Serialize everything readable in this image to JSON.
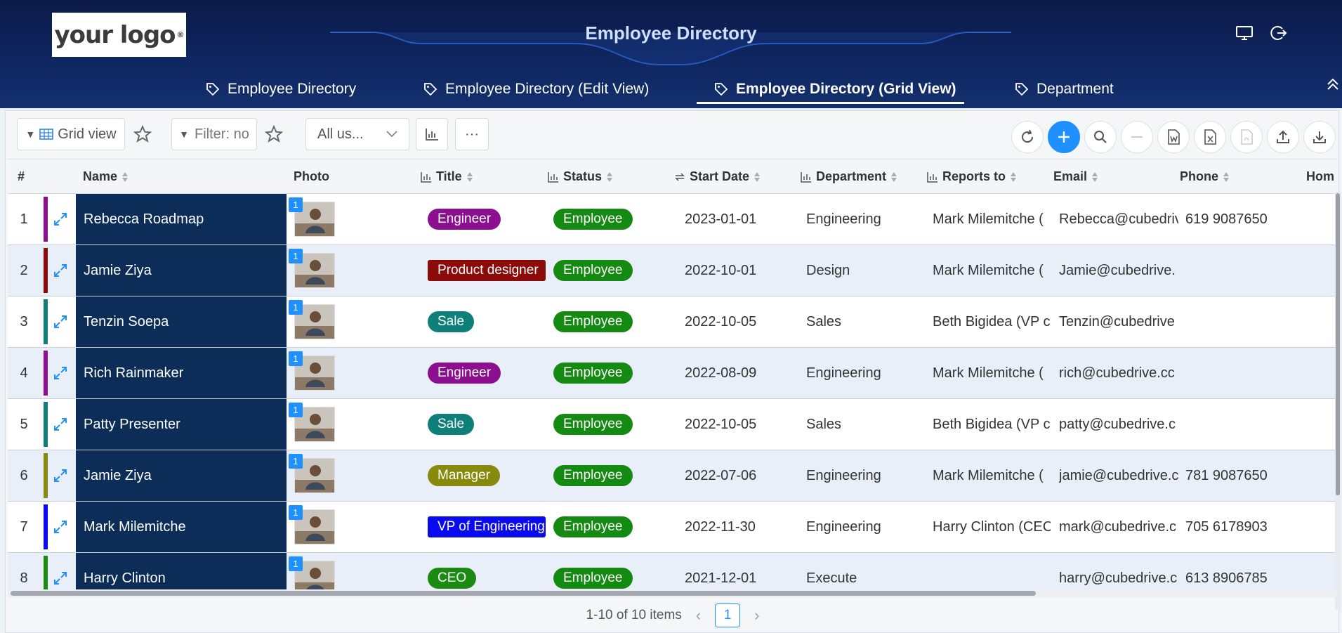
{
  "logo": {
    "text": "your logo",
    "mark": "®"
  },
  "app_title": "Employee Directory",
  "header_icons": [
    "monitor-icon",
    "logout-icon"
  ],
  "tabs": [
    {
      "label": "Employee Directory",
      "icon": "tag-icon",
      "active": false
    },
    {
      "label": "Employee Directory (Edit View)",
      "icon": "tag-icon",
      "active": false
    },
    {
      "label": "Employee Directory (Grid View)",
      "icon": "tag-icon",
      "active": true
    },
    {
      "label": "Department",
      "icon": "tag-icon",
      "active": false
    }
  ],
  "toolbar": {
    "view_label": "Grid view",
    "filter_placeholder": "Filter: no",
    "user_select": "All us...",
    "more_label": "···",
    "actions": [
      "refresh-icon",
      "add-icon",
      "search-icon",
      "remove-icon",
      "word-export-icon",
      "excel-export-icon",
      "pdf-export-icon",
      "upload-icon",
      "download-icon"
    ]
  },
  "columns": {
    "num": "#",
    "name": "Name",
    "photo": "Photo",
    "title": "Title",
    "status": "Status",
    "start_date": "Start Date",
    "department": "Department",
    "reports_to": "Reports to",
    "email": "Email",
    "phone": "Phone",
    "home": "Hom"
  },
  "rows": [
    {
      "num": "1",
      "name": "Rebecca Roadmap",
      "badge": "1",
      "title": "Engineer",
      "title_color": "#8b0f8e",
      "status": "Employee",
      "start_date": "2023-01-01",
      "department": "Engineering",
      "reports_to": "Mark Milemitche (",
      "email": "Rebecca@cubedriv",
      "phone": "619 9087650",
      "bar_color": "#8b0f8e"
    },
    {
      "num": "2",
      "name": "Jamie Ziya",
      "badge": "1",
      "title": "Product designer",
      "title_color": "#8b0a0a",
      "status": "Employee",
      "start_date": "2022-10-01",
      "department": "Design",
      "reports_to": "Mark Milemitche (",
      "email": "Jamie@cubedrive.",
      "phone": "",
      "bar_color": "#8b0a0a"
    },
    {
      "num": "3",
      "name": "Tenzin Soepa",
      "badge": "1",
      "title": "Sale",
      "title_color": "#0f7f7a",
      "status": "Employee",
      "start_date": "2022-10-05",
      "department": "Sales",
      "reports_to": "Beth Bigidea (VP c",
      "email": "Tenzin@cubedrive",
      "phone": "",
      "bar_color": "#0f7f7a"
    },
    {
      "num": "4",
      "name": "Rich Rainmaker",
      "badge": "1",
      "title": "Engineer",
      "title_color": "#8b0f8e",
      "status": "Employee",
      "start_date": "2022-08-09",
      "department": "Engineering",
      "reports_to": "Mark Milemitche (",
      "email": "rich@cubedrive.cc",
      "phone": "",
      "bar_color": "#8b0f8e"
    },
    {
      "num": "5",
      "name": "Patty Presenter",
      "badge": "1",
      "title": "Sale",
      "title_color": "#0f7f7a",
      "status": "Employee",
      "start_date": "2022-10-05",
      "department": "Sales",
      "reports_to": "Beth Bigidea (VP c",
      "email": "patty@cubedrive.c",
      "phone": "",
      "bar_color": "#0f7f7a"
    },
    {
      "num": "6",
      "name": "Jamie Ziya",
      "badge": "1",
      "title": "Manager",
      "title_color": "#878a0c",
      "status": "Employee",
      "start_date": "2022-07-06",
      "department": "Engineering",
      "reports_to": "Mark Milemitche (",
      "email": "jamie@cubedrive.c",
      "phone": "781 9087650",
      "bar_color": "#878a0c"
    },
    {
      "num": "7",
      "name": "Mark Milemitche",
      "badge": "1",
      "title": "VP of Engineering",
      "title_color": "#0a0af0",
      "status": "Employee",
      "start_date": "2022-11-30",
      "department": "Engineering",
      "reports_to": "Harry Clinton (CEC",
      "email": "mark@cubedrive.c",
      "phone": "705 6178903",
      "bar_color": "#0a0af0"
    },
    {
      "num": "8",
      "name": "Harry Clinton",
      "badge": "1",
      "title": "CEO",
      "title_color": "#1a8a12",
      "status": "Employee",
      "start_date": "2021-12-01",
      "department": "Execute",
      "reports_to": "",
      "email": "harry@cubedrive.c",
      "phone": "613 8906785",
      "bar_color": "#1a8a12"
    }
  ],
  "status_color": "#158a12",
  "name_bg": "#0c2d57",
  "pager": {
    "summary": "1-10 of 10 items",
    "page": "1"
  }
}
